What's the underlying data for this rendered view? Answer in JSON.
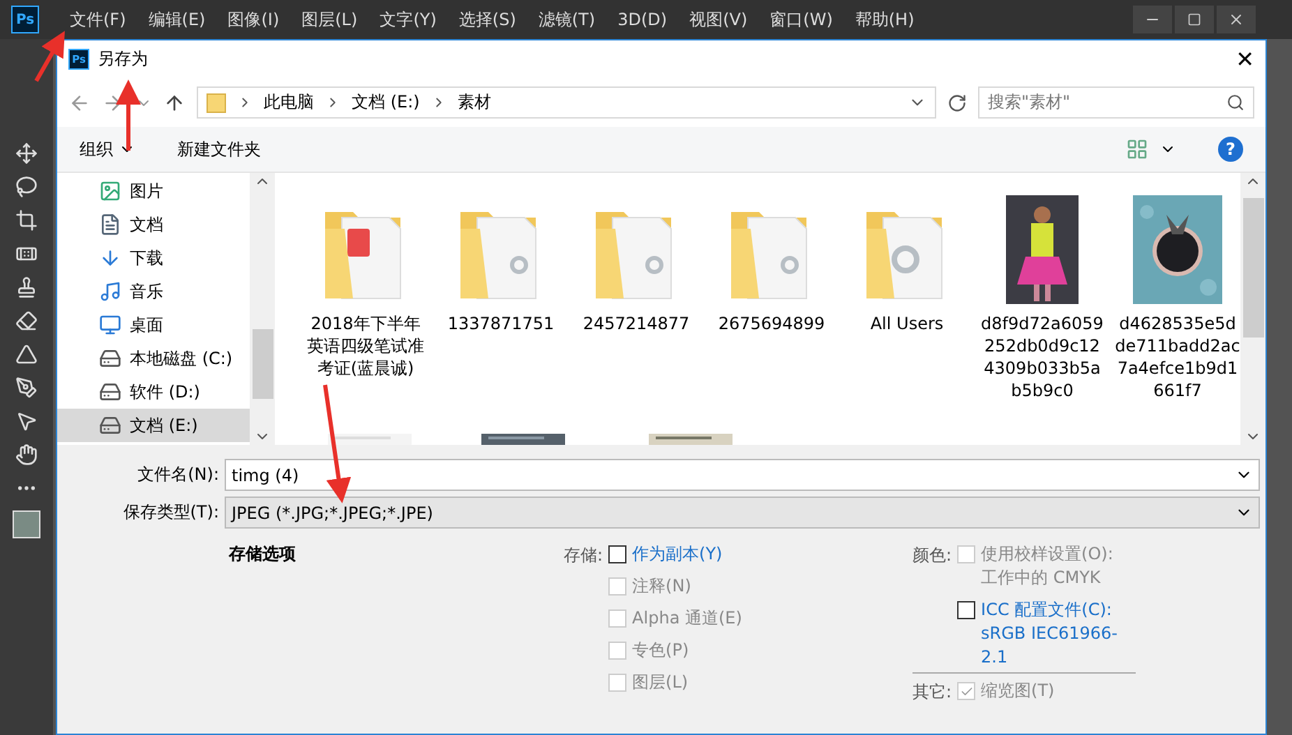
{
  "app": {
    "menu": [
      "文件(F)",
      "编辑(E)",
      "图像(I)",
      "图层(L)",
      "文字(Y)",
      "选择(S)",
      "滤镜(T)",
      "3D(D)",
      "视图(V)",
      "窗口(W)",
      "帮助(H)"
    ],
    "logo": "Ps"
  },
  "dialog": {
    "logo": "Ps",
    "title": "另存为",
    "close": "✕",
    "breadcrumb": [
      "此电脑",
      "文档 (E:)",
      "素材"
    ],
    "search": {
      "placeholder": "搜索\"素材\""
    },
    "toolbar": {
      "organize": "组织",
      "new_folder": "新建文件夹",
      "help": "?"
    },
    "nav_items": [
      {
        "kind": "pictures",
        "label": "图片",
        "selected": false
      },
      {
        "kind": "documents",
        "label": "文档",
        "selected": false
      },
      {
        "kind": "downloads",
        "label": "下载",
        "selected": false
      },
      {
        "kind": "music",
        "label": "音乐",
        "selected": false
      },
      {
        "kind": "desktop",
        "label": "桌面",
        "selected": false
      },
      {
        "kind": "system-drive",
        "label": "本地磁盘 (C:)",
        "selected": false
      },
      {
        "kind": "drive",
        "label": "软件 (D:)",
        "selected": false
      },
      {
        "kind": "drive",
        "label": "文档 (E:)",
        "selected": true
      }
    ],
    "files": [
      {
        "kind": "pdf-folder",
        "name": "2018年下半年英语四级笔试准考证(蓝晨诚)"
      },
      {
        "kind": "folder",
        "name": "1337871751"
      },
      {
        "kind": "folder",
        "name": "2457214877"
      },
      {
        "kind": "folder",
        "name": "2675694899"
      },
      {
        "kind": "gear-folder",
        "name": "All Users"
      },
      {
        "name": "d8f9d72a6059252db0d9c124309b033b5ab5b9c0"
      },
      {
        "kind": "pattern",
        "name": "d4628535e5dde711badd2ac7a4efce1b9d1661f7"
      }
    ],
    "filename": {
      "label": "文件名(N):",
      "value": "timg (4)"
    },
    "filetype": {
      "label": "保存类型(T):",
      "value": "JPEG (*.JPG;*.JPEG;*.JPE)"
    },
    "options_title": "存储选项",
    "store": {
      "label": "存储:",
      "checkboxes": [
        {
          "label": "作为副本(Y)",
          "checked": false,
          "disabled": false
        },
        {
          "label": "注释(N)",
          "checked": false,
          "disabled": true
        },
        {
          "label": "Alpha 通道(E)",
          "checked": false,
          "disabled": true
        },
        {
          "label": "专色(P)",
          "checked": false,
          "disabled": true
        },
        {
          "label": "图层(L)",
          "checked": false,
          "disabled": true
        }
      ]
    },
    "color": {
      "label": "颜色:",
      "checkboxes": [
        {
          "label": "使用校样设置(O):  工作中的 CMYK",
          "checked": false,
          "disabled": true
        },
        {
          "label": "ICC 配置文件(C): sRGB IEC61966-2.1",
          "checked": false,
          "disabled": false
        }
      ]
    },
    "other": {
      "label": "其它:",
      "checkboxes": [
        {
          "label": "缩览图(T)",
          "checked": true,
          "disabled": true
        }
      ]
    }
  }
}
